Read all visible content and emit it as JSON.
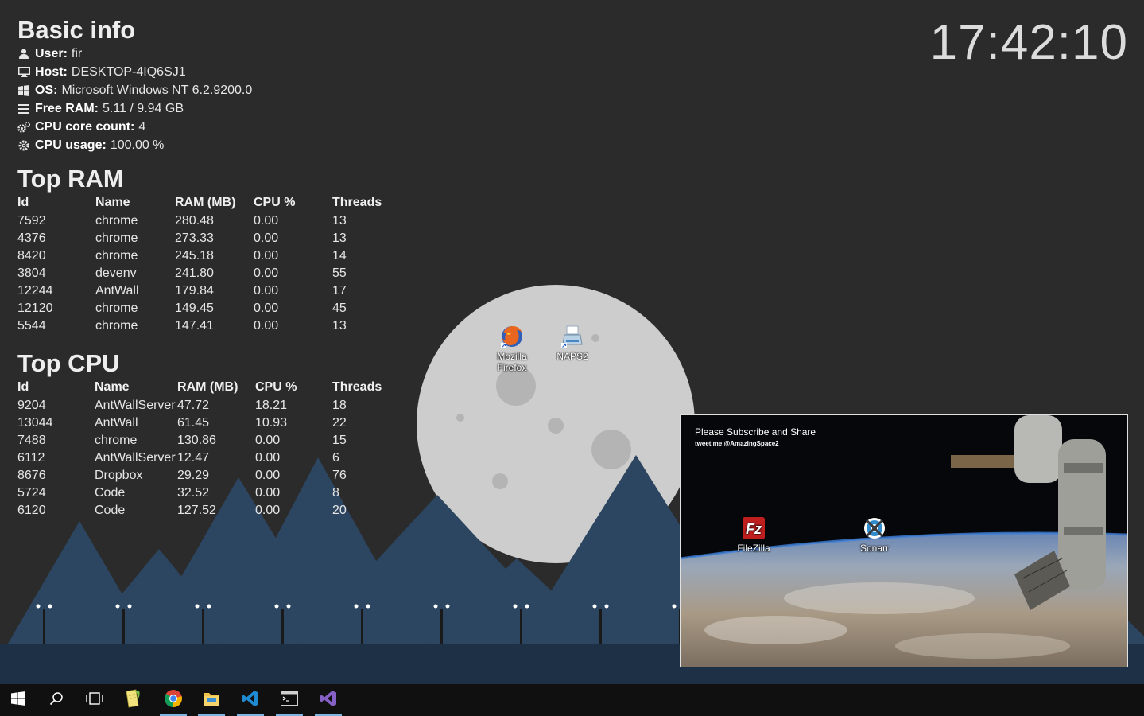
{
  "clock": "17:42:10",
  "basic_info": {
    "title": "Basic info",
    "rows": [
      {
        "icon": "user-icon",
        "label": "User:",
        "value": "fir"
      },
      {
        "icon": "monitor-icon",
        "label": "Host:",
        "value": "DESKTOP-4IQ6SJ1"
      },
      {
        "icon": "windows-icon",
        "label": "OS:",
        "value": "Microsoft Windows NT 6.2.9200.0"
      },
      {
        "icon": "memory-icon",
        "label": "Free RAM:",
        "value": "5.11 / 9.94 GB"
      },
      {
        "icon": "cogs-icon",
        "label": "CPU core count:",
        "value": "4"
      },
      {
        "icon": "gear-icon",
        "label": "CPU usage:",
        "value": "100.00 %"
      }
    ]
  },
  "top_ram": {
    "title": "Top RAM",
    "columns": [
      "Id",
      "Name",
      "RAM (MB)",
      "CPU %",
      "Threads"
    ],
    "rows": [
      [
        "7592",
        "chrome",
        "280.48",
        "0.00",
        "13"
      ],
      [
        "4376",
        "chrome",
        "273.33",
        "0.00",
        "13"
      ],
      [
        "8420",
        "chrome",
        "245.18",
        "0.00",
        "14"
      ],
      [
        "3804",
        "devenv",
        "241.80",
        "0.00",
        "55"
      ],
      [
        "12244",
        "AntWall",
        "179.84",
        "0.00",
        "17"
      ],
      [
        "12120",
        "chrome",
        "149.45",
        "0.00",
        "45"
      ],
      [
        "5544",
        "chrome",
        "147.41",
        "0.00",
        "13"
      ]
    ]
  },
  "top_cpu": {
    "title": "Top CPU",
    "columns": [
      "Id",
      "Name",
      "RAM (MB)",
      "CPU %",
      "Threads"
    ],
    "rows": [
      [
        "9204",
        "AntWallServer",
        "47.72",
        "18.21",
        "18"
      ],
      [
        "13044",
        "AntWall",
        "61.45",
        "10.93",
        "22"
      ],
      [
        "7488",
        "chrome",
        "130.86",
        "0.00",
        "15"
      ],
      [
        "6112",
        "AntWallServer",
        "12.47",
        "0.00",
        "6"
      ],
      [
        "8676",
        "Dropbox",
        "29.29",
        "0.00",
        "76"
      ],
      [
        "5724",
        "Code",
        "32.52",
        "0.00",
        "8"
      ],
      [
        "6120",
        "Code",
        "127.52",
        "0.00",
        "20"
      ]
    ]
  },
  "desktop_icons": {
    "firefox": "Mozilla Firefox",
    "naps2": "NAPS2",
    "filezilla": "FileZilla",
    "sonarr": "Sonarr"
  },
  "video": {
    "line1": "Please Subscribe and Share",
    "line2": "tweet me @AmazingSpace2"
  },
  "taskbar": {
    "items": [
      "start-icon",
      "search-icon",
      "task-view-icon",
      "notepad-plus-plus-icon",
      "chrome-icon",
      "file-explorer-icon",
      "vscode-icon",
      "terminal-icon",
      "visual-studio-icon"
    ]
  },
  "colors": {
    "background": "#2b2b2b",
    "moon": "#cfcfcf",
    "mountains": "#2c4560",
    "ground": "#1e3046",
    "taskbar": "#101010",
    "accent": "#7fb4e0"
  }
}
